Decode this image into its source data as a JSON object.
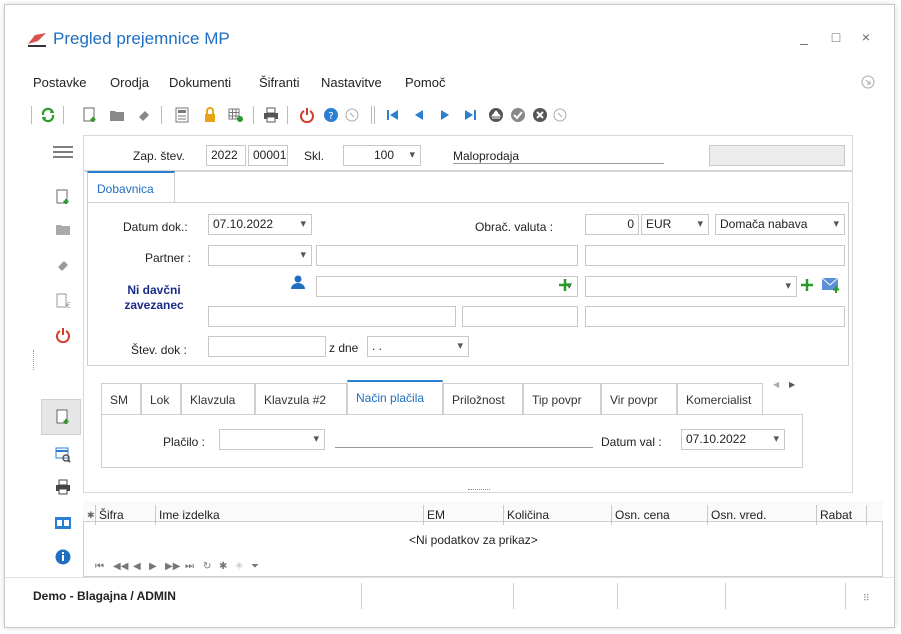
{
  "window": {
    "title": "Pregled prejemnice MP",
    "minimize": "_",
    "maximize": "□",
    "close": "×"
  },
  "menu": [
    "Postavke",
    "Orodja",
    "Dokumenti",
    "Šifranti",
    "Nastavitve",
    "Pomoč"
  ],
  "header": {
    "zap_label": "Zap. štev.",
    "zap_year": "2022",
    "zap_number": "00001",
    "skl_label": "Skl.",
    "skl_value": "100",
    "skl_name": "Maloprodaja"
  },
  "doc_tab": "Dobavnica",
  "form": {
    "datum_label": "Datum dok.:",
    "datum_value": "07.10.2022",
    "valuta_label": "Obrač. valuta :",
    "valuta_amount": "0",
    "valuta_currency": "EUR",
    "nabava": "Domača nabava",
    "partner_label": "Partner :",
    "tax_label": "Ni davčni zavezanec",
    "stev_label": "Štev. dok :",
    "zdne_label": "z dne",
    "zdne_value": ". ."
  },
  "tabs": [
    "SM",
    "Lok",
    "Klavzula",
    "Klavzula #2",
    "Način plačila",
    "Priložnost",
    "Tip povpr",
    "Vir povpr",
    "Komercialist"
  ],
  "active_tab": "Način plačila",
  "payment": {
    "placilo_label": "Plačilo :",
    "datum_val_label": "Datum val :",
    "datum_val_value": "07.10.2022"
  },
  "grid": {
    "columns": [
      "Šifra",
      "Ime izdelka",
      "EM",
      "Količina",
      "Osn. cena",
      "Osn. vred.",
      "Rabat"
    ],
    "empty": "<Ni podatkov za prikaz>"
  },
  "status": {
    "text": "Demo - Blagajna / ADMIN"
  },
  "colors": {
    "accent": "#1e6fc0",
    "green": "#2a9b2a",
    "red": "#d23a2a"
  }
}
